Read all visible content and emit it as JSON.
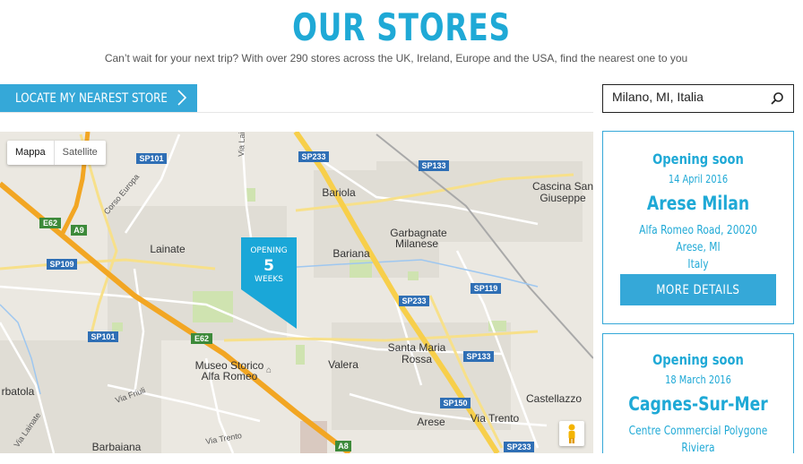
{
  "header": {
    "title": "OUR STORES",
    "subtitle": "Can’t wait for your next trip? With over 290 stores across the UK, Ireland, Europe and the USA, find the nearest one to you"
  },
  "locate": {
    "label": "LOCATE MY NEAREST STORE"
  },
  "search": {
    "value": "Milano, MI, Italia"
  },
  "map": {
    "type_buttons": [
      "Mappa",
      "Satellite"
    ],
    "road_badges": [
      "SP101",
      "SP233",
      "SP133",
      "A9",
      "E62",
      "SP109",
      "SP101",
      "E62",
      "SP233",
      "SP119",
      "SP133",
      "SP150",
      "SP233",
      "A8"
    ],
    "places": [
      "Bariola",
      "Garbagnate",
      "Milanese",
      "Lainate",
      "Bariana",
      "Cascina San",
      "Giuseppe",
      "Santa Maria",
      "Rossa",
      "Valera",
      "Museo Storico",
      "Alfa Romeo",
      "Castellazzo",
      "Arese",
      "Via Trento",
      "Barbaiana",
      "rbatola",
      "Corso Europa",
      "Via Friuli",
      "Via Trento",
      "Via Lainate",
      "Via Lai"
    ],
    "marker": {
      "line1": "OPENING",
      "line2": "5",
      "line3": "WEEKS"
    }
  },
  "stores": [
    {
      "status": "Opening soon",
      "date": "14 April 2016",
      "name": "Arese Milan",
      "address": [
        "Alfa Romeo Road, 20020",
        "Arese, MI",
        "Italy"
      ],
      "button": "MORE DETAILS"
    },
    {
      "status": "Opening soon",
      "date": "18 March 2016",
      "name": "Cagnes-Sur-Mer",
      "address": [
        "Centre Commercial Polygone",
        "Riviera"
      ]
    }
  ],
  "colors": {
    "accent": "#35a8d8",
    "road_orange": "#f2a623",
    "road_yellow": "#f7cf4b",
    "map_bg": "#ebe8e1"
  }
}
